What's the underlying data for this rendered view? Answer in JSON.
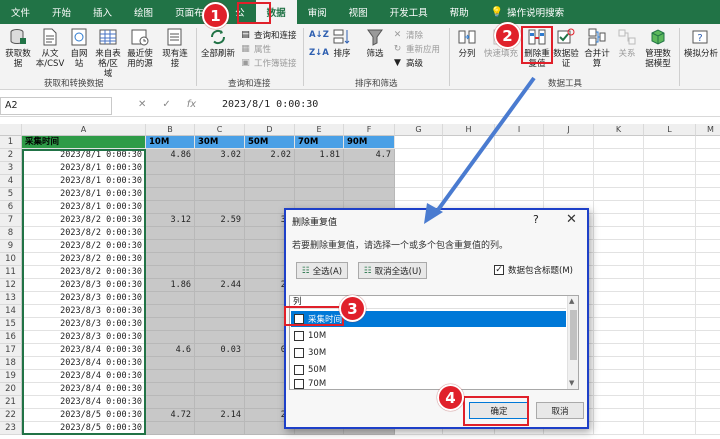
{
  "menu": {
    "items": [
      "文件",
      "开始",
      "插入",
      "绘图",
      "页面布局",
      "公",
      "数据",
      "审阅",
      "视图",
      "开发工具",
      "帮助",
      "操作说明搜索"
    ],
    "active_index": 6
  },
  "ribbon": {
    "get_data": "获取数据",
    "from_text": "从文本/CSV",
    "from_web": "自网站",
    "from_table": "来自表格/区域",
    "recent_sources": "最近使用的源",
    "existing_conn": "现有连接",
    "group_get": "获取和转换数据",
    "refresh_all": "全部刷新",
    "queries_conn": "查询和连接",
    "properties": "属性",
    "edit_links": "工作簿链接",
    "group_queries": "查询和连接",
    "sort_az": "A↓Z",
    "sort_za": "Z↓A",
    "sort": "排序",
    "filter": "筛选",
    "clear": "清除",
    "reapply": "重新应用",
    "advanced": "高级",
    "group_sort": "排序和筛选",
    "text_to_columns": "分列",
    "flash_fill": "快速填充",
    "remove_duplicates": "删除重复值",
    "data_validation": "数据验证",
    "consolidate": "合并计算",
    "relationships": "关系",
    "data_model": "管理数据模型",
    "group_tools": "数据工具",
    "whatif": "模拟分析"
  },
  "formula_bar": {
    "name_box": "A2",
    "cancel": "✕",
    "enter": "✓",
    "fx": "fx",
    "value": "2023/8/1  0:00:30"
  },
  "sheet": {
    "columns": [
      "A",
      "B",
      "C",
      "D",
      "E",
      "F",
      "G",
      "H",
      "I",
      "J",
      "K",
      "L",
      "M"
    ],
    "header_row": [
      "采集时间",
      "10M",
      "30M",
      "50M",
      "70M",
      "90M"
    ],
    "rows": [
      {
        "n": "2",
        "a": "2023/8/1  0:00:30",
        "b": "4.86",
        "c": "3.02",
        "d": "2.02",
        "e": "1.81",
        "f": "4.7"
      },
      {
        "n": "3",
        "a": "2023/8/1  0:00:30",
        "b": "",
        "c": "",
        "d": "",
        "e": "",
        "f": ""
      },
      {
        "n": "4",
        "a": "2023/8/1  0:00:30",
        "b": "",
        "c": "",
        "d": "",
        "e": "",
        "f": ""
      },
      {
        "n": "5",
        "a": "2023/8/1  0:00:30",
        "b": "",
        "c": "",
        "d": "",
        "e": "",
        "f": ""
      },
      {
        "n": "6",
        "a": "2023/8/1  0:00:30",
        "b": "",
        "c": "",
        "d": "",
        "e": "",
        "f": ""
      },
      {
        "n": "7",
        "a": "2023/8/2  0:00:30",
        "b": "3.12",
        "c": "2.59",
        "d": "3.",
        "e": "",
        "f": ""
      },
      {
        "n": "8",
        "a": "2023/8/2  0:00:30",
        "b": "",
        "c": "",
        "d": "",
        "e": "",
        "f": ""
      },
      {
        "n": "9",
        "a": "2023/8/2  0:00:30",
        "b": "",
        "c": "",
        "d": "",
        "e": "",
        "f": ""
      },
      {
        "n": "10",
        "a": "2023/8/2  0:00:30",
        "b": "",
        "c": "",
        "d": "",
        "e": "",
        "f": ""
      },
      {
        "n": "11",
        "a": "2023/8/2  0:00:30",
        "b": "",
        "c": "",
        "d": "",
        "e": "",
        "f": ""
      },
      {
        "n": "12",
        "a": "2023/8/3  0:00:30",
        "b": "1.86",
        "c": "2.44",
        "d": "2.",
        "e": "",
        "f": ""
      },
      {
        "n": "13",
        "a": "2023/8/3  0:00:30",
        "b": "",
        "c": "",
        "d": "",
        "e": "",
        "f": ""
      },
      {
        "n": "14",
        "a": "2023/8/3  0:00:30",
        "b": "",
        "c": "",
        "d": "",
        "e": "",
        "f": ""
      },
      {
        "n": "15",
        "a": "2023/8/3  0:00:30",
        "b": "",
        "c": "",
        "d": "",
        "e": "",
        "f": ""
      },
      {
        "n": "16",
        "a": "2023/8/3  0:00:30",
        "b": "",
        "c": "",
        "d": "",
        "e": "",
        "f": ""
      },
      {
        "n": "17",
        "a": "2023/8/4  0:00:30",
        "b": "4.6",
        "c": "0.03",
        "d": "0.",
        "e": "",
        "f": ""
      },
      {
        "n": "18",
        "a": "2023/8/4  0:00:30",
        "b": "",
        "c": "",
        "d": "",
        "e": "",
        "f": ""
      },
      {
        "n": "19",
        "a": "2023/8/4  0:00:30",
        "b": "",
        "c": "",
        "d": "",
        "e": "",
        "f": ""
      },
      {
        "n": "20",
        "a": "2023/8/4  0:00:30",
        "b": "",
        "c": "",
        "d": "",
        "e": "",
        "f": ""
      },
      {
        "n": "21",
        "a": "2023/8/4  0:00:30",
        "b": "",
        "c": "",
        "d": "",
        "e": "",
        "f": ""
      },
      {
        "n": "22",
        "a": "2023/8/5  0:00:30",
        "b": "4.72",
        "c": "2.14",
        "d": "2.",
        "e": "",
        "f": ""
      },
      {
        "n": "23",
        "a": "2023/8/5  0:00:30",
        "b": "",
        "c": "",
        "d": "",
        "e": "",
        "f": ""
      }
    ]
  },
  "dialog": {
    "title": "删除重复值",
    "help": "?",
    "close": "✕",
    "message": "若要删除重复值，请选择一个或多个包含重复值的列。",
    "select_all": "全选(A)",
    "unselect_all": "取消全选(U)",
    "has_headers": "数据包含标题(M)",
    "list_header": "列",
    "columns": [
      {
        "label": "采集时间",
        "checked": true,
        "selected": true
      },
      {
        "label": "10M",
        "checked": false,
        "selected": false
      },
      {
        "label": "30M",
        "checked": false,
        "selected": false
      },
      {
        "label": "50M",
        "checked": false,
        "selected": false
      },
      {
        "label": "70M",
        "checked": false,
        "selected": false
      }
    ],
    "ok": "确定",
    "cancel": "取消"
  },
  "annotations": {
    "step1": "1",
    "step2": "2",
    "step3": "3",
    "step4": "4",
    "highlight_color": "#e0202a",
    "arrow_color": "#4a7bd0"
  },
  "colors": {
    "excel_green": "#217346",
    "header_fill": "#4aa0e6",
    "column_a_header_fill": "#2e9b47",
    "selected_fill": "#c8c8c8",
    "selection_blue": "#0078d7",
    "dialog_border": "#1e40c8"
  }
}
